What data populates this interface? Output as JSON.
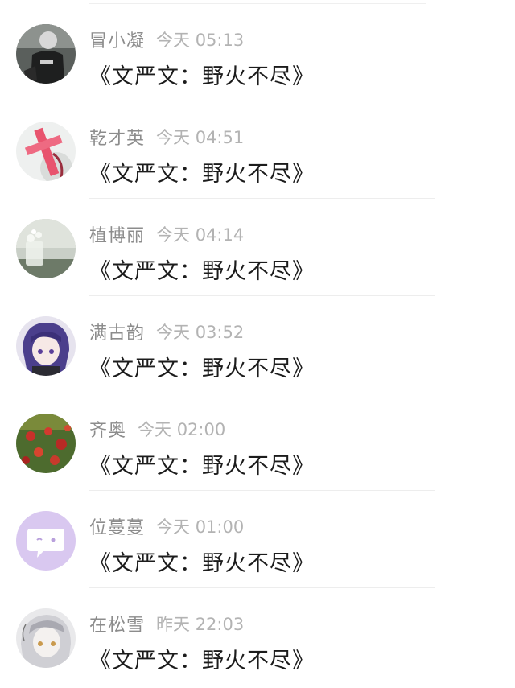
{
  "comments": [
    {
      "name": "冒小凝",
      "time": "今天 05:13",
      "message": "《文严文：野火不尽》",
      "avatar_icon": "avatar-dark-person"
    },
    {
      "name": "乾才英",
      "time": "今天 04:51",
      "message": "《文严文：野火不尽》",
      "avatar_icon": "avatar-pink-cross"
    },
    {
      "name": "植博丽",
      "time": "今天 04:14",
      "message": "《文严文：野火不尽》",
      "avatar_icon": "avatar-glass-vase"
    },
    {
      "name": "满古韵",
      "time": "今天 03:52",
      "message": "《文严文：野火不尽》",
      "avatar_icon": "avatar-anime-purple-hair"
    },
    {
      "name": "齐奥",
      "time": "今天 02:00",
      "message": "《文严文：野火不尽》",
      "avatar_icon": "avatar-red-flowers"
    },
    {
      "name": "位蔓蔓",
      "time": "今天 01:00",
      "message": "《文严文：野火不尽》",
      "avatar_icon": "avatar-chat-bubble-default"
    },
    {
      "name": "在松雪",
      "time": "昨天 22:03",
      "message": "《文严文：野火不尽》",
      "avatar_icon": "avatar-anime-sketch"
    }
  ],
  "colors": {
    "name": "#8c8c8c",
    "time": "#b3b3b3",
    "message": "#1c1c1c",
    "default_avatar_bg": "#d9c8f0"
  }
}
